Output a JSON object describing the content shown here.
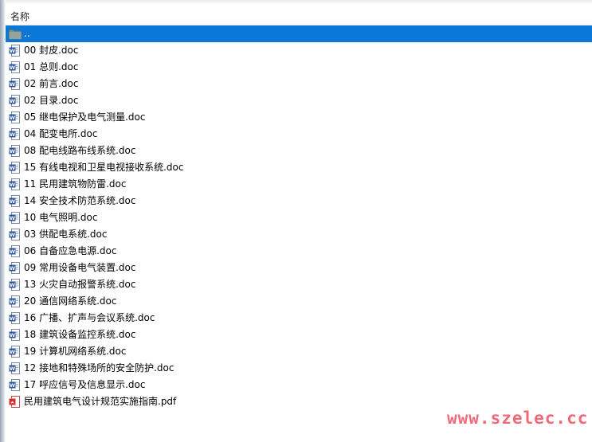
{
  "header": {
    "name_column": "名称"
  },
  "files": [
    {
      "name": "..",
      "type": "folder",
      "selected": true
    },
    {
      "name": "00 封皮.doc",
      "type": "doc"
    },
    {
      "name": "01 总则.doc",
      "type": "doc"
    },
    {
      "name": "02 前言.doc",
      "type": "doc"
    },
    {
      "name": "02 目录.doc",
      "type": "doc"
    },
    {
      "name": "05 继电保护及电气测量.doc",
      "type": "doc"
    },
    {
      "name": "04 配变电所.doc",
      "type": "doc"
    },
    {
      "name": "08 配电线路布线系统.doc",
      "type": "doc"
    },
    {
      "name": "15 有线电视和卫星电视接收系统.doc",
      "type": "doc"
    },
    {
      "name": "11 民用建筑物防雷.doc",
      "type": "doc"
    },
    {
      "name": "14 安全技术防范系统.doc",
      "type": "doc"
    },
    {
      "name": "10 电气照明.doc",
      "type": "doc"
    },
    {
      "name": "03 供配电系统.doc",
      "type": "doc"
    },
    {
      "name": "06 自备应急电源.doc",
      "type": "doc"
    },
    {
      "name": "09 常用设备电气装置.doc",
      "type": "doc"
    },
    {
      "name": "13 火灾自动报警系统.doc",
      "type": "doc"
    },
    {
      "name": "20 通信网络系统.doc",
      "type": "doc"
    },
    {
      "name": "16 广播、扩声与会议系统.doc",
      "type": "doc"
    },
    {
      "name": "18 建筑设备监控系统.doc",
      "type": "doc"
    },
    {
      "name": "19 计算机网络系统.doc",
      "type": "doc"
    },
    {
      "name": "12 接地和特殊场所的安全防护.doc",
      "type": "doc"
    },
    {
      "name": "17 呼应信号及信息显示.doc",
      "type": "doc"
    },
    {
      "name": "民用建筑电气设计规范实施指南.pdf",
      "type": "pdf"
    }
  ],
  "watermark": "www.szelec.cc",
  "colors": {
    "selection": "#0a78d7",
    "watermark": "#f06a79"
  }
}
